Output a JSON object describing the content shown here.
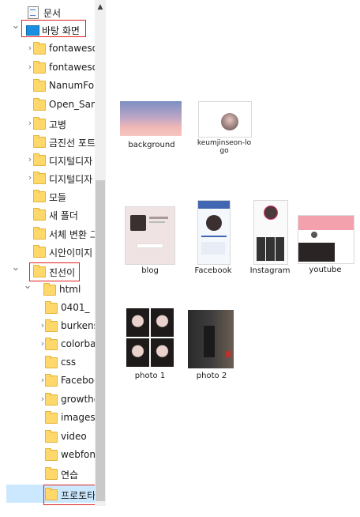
{
  "tree": [
    {
      "label": "문서",
      "icon": "document-icon",
      "expander": "collapsed"
    },
    {
      "label": "바탕 화면",
      "icon": "desktop-icon",
      "expander": "expanded"
    },
    {
      "label": "fontawesor",
      "icon": "folder-icon",
      "expander": "collapsed"
    },
    {
      "label": "fontawesor",
      "icon": "folder-icon",
      "expander": "collapsed"
    },
    {
      "label": "NanumFon",
      "icon": "folder-icon",
      "expander": "none"
    },
    {
      "label": "Open_Sans",
      "icon": "folder-icon",
      "expander": "none"
    },
    {
      "label": "고병",
      "icon": "folder-icon",
      "expander": "collapsed"
    },
    {
      "label": "금진선 포트",
      "icon": "folder-icon",
      "expander": "none"
    },
    {
      "label": "디지털디자",
      "icon": "folder-icon",
      "expander": "collapsed"
    },
    {
      "label": "디지털디자",
      "icon": "folder-icon",
      "expander": "collapsed"
    },
    {
      "label": "모들",
      "icon": "folder-icon",
      "expander": "none"
    },
    {
      "label": "새 폴더",
      "icon": "folder-icon",
      "expander": "none"
    },
    {
      "label": "서체 변환 그",
      "icon": "folder-icon",
      "expander": "none"
    },
    {
      "label": "시안이미지",
      "icon": "folder-icon",
      "expander": "none"
    },
    {
      "label": "진선이",
      "icon": "folder-icon",
      "expander": "expanded"
    },
    {
      "label": "html",
      "icon": "folder-icon",
      "expander": "expanded"
    },
    {
      "label": "0401_",
      "icon": "folder-icon",
      "expander": "none"
    },
    {
      "label": "burkenst",
      "icon": "folder-icon",
      "expander": "collapsed"
    },
    {
      "label": "colorbag",
      "icon": "folder-icon",
      "expander": "collapsed"
    },
    {
      "label": "css",
      "icon": "folder-icon",
      "expander": "none"
    },
    {
      "label": "Faceboo",
      "icon": "folder-icon",
      "expander": "collapsed"
    },
    {
      "label": "growthc",
      "icon": "folder-icon",
      "expander": "collapsed"
    },
    {
      "label": "images",
      "icon": "folder-icon",
      "expander": "none"
    },
    {
      "label": "video",
      "icon": "folder-icon",
      "expander": "none"
    },
    {
      "label": "webfont",
      "icon": "folder-icon",
      "expander": "none"
    },
    {
      "label": "연습",
      "icon": "folder-icon",
      "expander": "none"
    },
    {
      "label": "프로토타",
      "icon": "folder-icon",
      "expander": "none"
    }
  ],
  "files": [
    {
      "name": "background",
      "thumb": "sky"
    },
    {
      "name": "keumjinseon-logo",
      "thumb": "logo"
    },
    {
      "name": "blog",
      "thumb": "blog"
    },
    {
      "name": "Facebook",
      "thumb": "phone"
    },
    {
      "name": "Instagram",
      "thumb": "phone2"
    },
    {
      "name": "youtube",
      "thumb": "yt"
    },
    {
      "name": "photo 1",
      "thumb": "grid"
    },
    {
      "name": "photo 2",
      "thumb": "dark"
    }
  ]
}
